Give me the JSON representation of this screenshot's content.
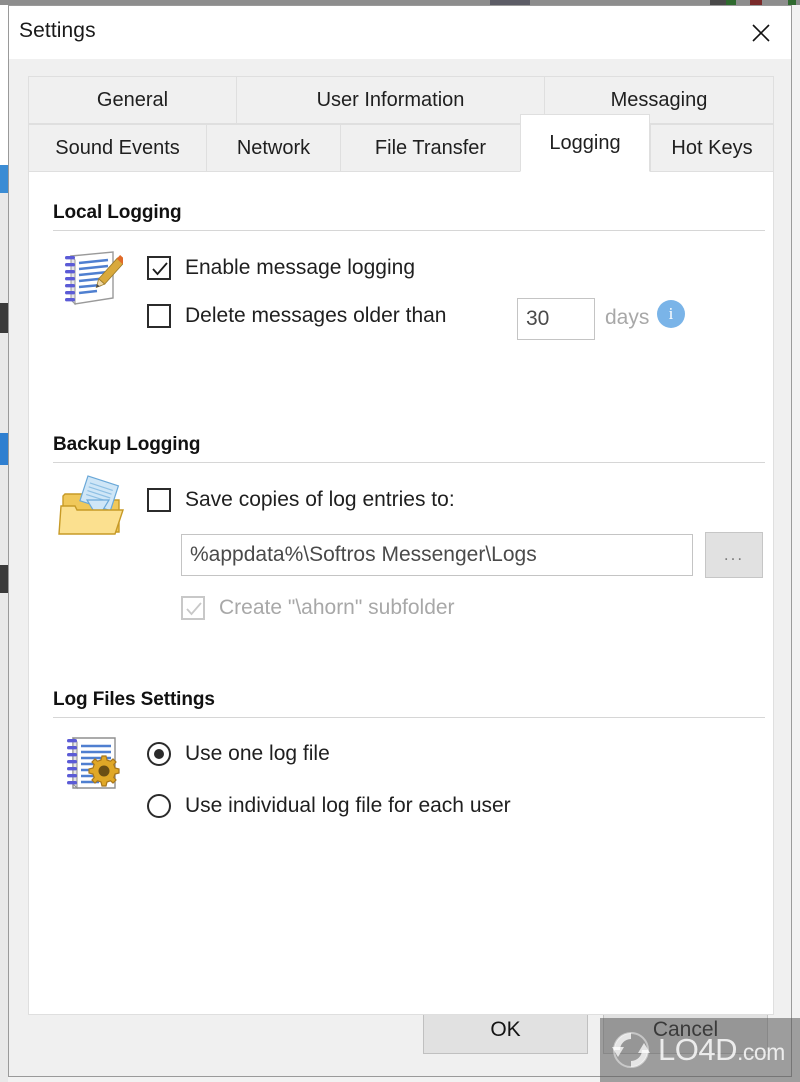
{
  "window": {
    "title": "Settings",
    "close_icon": "close-icon"
  },
  "tabs": {
    "row1": [
      {
        "label": "General",
        "active": false
      },
      {
        "label": "User Information",
        "active": false
      },
      {
        "label": "Messaging",
        "active": false
      }
    ],
    "row2": [
      {
        "label": "Sound Events",
        "active": false
      },
      {
        "label": "Network",
        "active": false
      },
      {
        "label": "File Transfer",
        "active": false
      },
      {
        "label": "Logging",
        "active": true
      },
      {
        "label": "Hot Keys",
        "active": false
      }
    ],
    "selected": "Logging"
  },
  "sections": {
    "local_logging": {
      "title": "Local Logging",
      "icon": "notepad-pencil-icon",
      "enable_logging": {
        "label": "Enable message logging",
        "checked": true,
        "enabled": true
      },
      "delete_older": {
        "label": "Delete messages older than",
        "checked": false,
        "enabled": true
      },
      "days_value": "30",
      "days_label": "days",
      "info_icon": "info-icon",
      "info_glyph": "i"
    },
    "backup_logging": {
      "title": "Backup Logging",
      "icon": "open-folder-documents-icon",
      "save_copies": {
        "label": "Save copies of log entries to:",
        "checked": false,
        "enabled": true
      },
      "path_value": "%appdata%\\Softros Messenger\\Logs",
      "browse_label": "...",
      "create_subfolder": {
        "label": "Create \"\\ahorn\" subfolder",
        "checked": true,
        "enabled": false
      }
    },
    "log_files_settings": {
      "title": "Log Files Settings",
      "icon": "notepad-gear-icon",
      "options": [
        {
          "label": "Use one log file",
          "selected": true
        },
        {
          "label": "Use individual log file for each user",
          "selected": false
        }
      ]
    }
  },
  "footer": {
    "ok_label": "OK",
    "cancel_label": "Cancel"
  },
  "watermark": {
    "text": "LO4D",
    "domain": ".com",
    "logo_icon": "circular-arrows-icon"
  },
  "colors": {
    "dialog_bg": "#f0f0f0",
    "content_bg": "#ffffff",
    "tab_inactive_bg": "#f0f0f0",
    "tab_active_bg": "#ffffff",
    "info_badge": "#7ab4e8",
    "button_bg": "#e1e1e1",
    "text": "#1f1f1f",
    "disabled_text": "#a8a8a8"
  }
}
